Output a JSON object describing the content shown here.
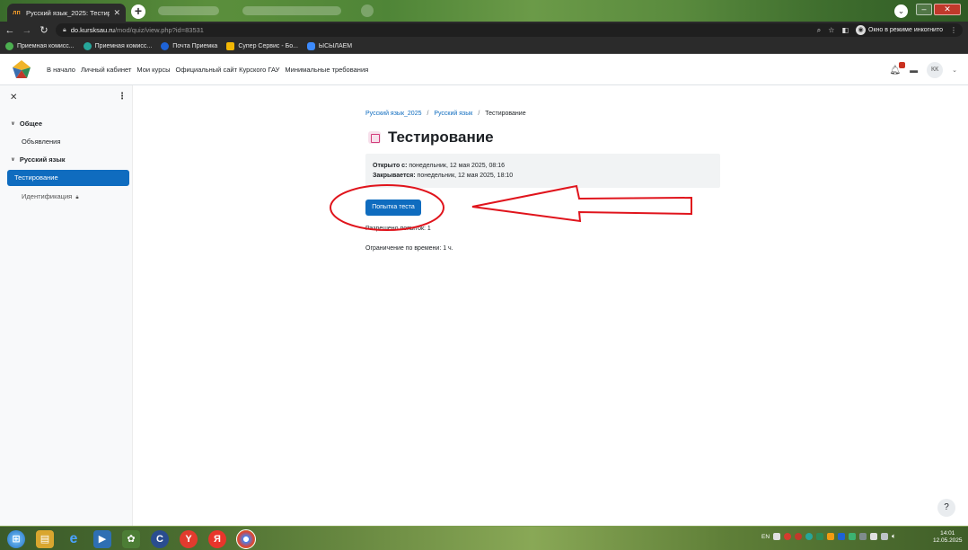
{
  "browser": {
    "active_tab_title": "Русский язык_2025: Тестирован...",
    "url_host": "do.kursksau.ru",
    "url_path": "/mod/quiz/view.php?id=83531",
    "incognito_label": "Окно в режиме инкогнито"
  },
  "bookmarks": [
    {
      "label": "Приемная комисс...",
      "color": "#4caf50"
    },
    {
      "label": "Приемная комисс...",
      "color": "#26a69a"
    },
    {
      "label": "Почта Приемка",
      "color": "#1e63d6"
    },
    {
      "label": "Супер Сервис - Бо...",
      "color": "#f2b705"
    },
    {
      "label": "ЫСЫЛАЕМ",
      "color": "#3d8bfd"
    }
  ],
  "navbar": {
    "links": [
      "В начало",
      "Личный кабинет",
      "Мои курсы",
      "Официальный сайт Курского ГАУ",
      "Минимальные требования"
    ],
    "avatar_initials": "КК"
  },
  "drawer": {
    "section1": "Общее",
    "item1": "Объявления",
    "section2": "Русский язык",
    "item_active": "Тестирование",
    "item_locked": "Идентификация"
  },
  "breadcrumb": [
    "Русский язык_2025",
    "Русский язык",
    "Тестирование"
  ],
  "page_title": "Тестирование",
  "dates": {
    "open_label": "Открыто с:",
    "open_value": "понедельник, 12 мая 2025, 08:16",
    "close_label": "Закрывается:",
    "close_value": "понедельник, 12 мая 2025, 18:10"
  },
  "attempt_button": "Попытка теста",
  "attempts_allowed": "Разрешено попыток: 1",
  "time_limit": "Ограничение по времени: 1 ч.",
  "help_label": "?",
  "taskbar": {
    "lang": "EN",
    "time": "14:01",
    "date": "12.05.2025"
  },
  "colors": {
    "primary": "#0f6cbf",
    "annotation": "#e0141c"
  }
}
